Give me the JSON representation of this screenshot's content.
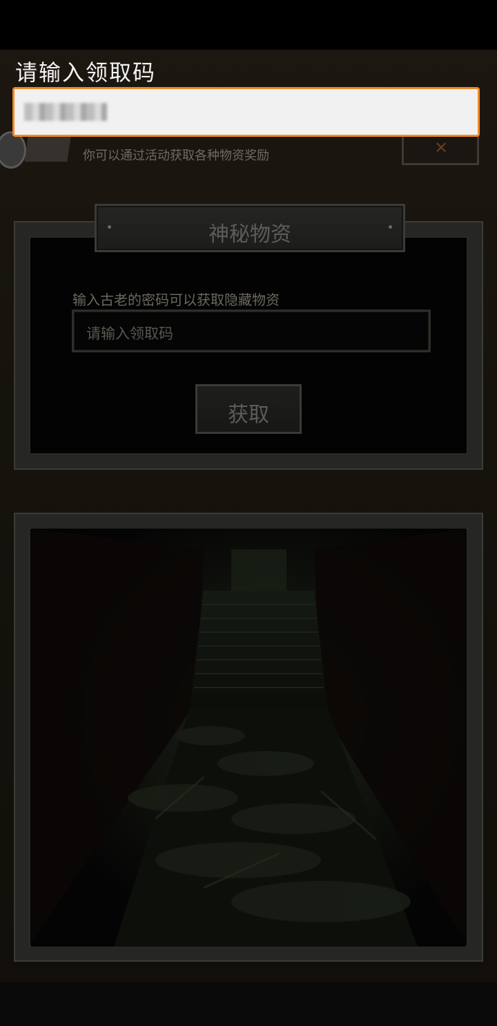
{
  "ime": {
    "prompt": "请输入领取码"
  },
  "header": {
    "subtitle": "你可以通过活动获取各种物资奖励"
  },
  "redeem_panel": {
    "title": "神秘物资",
    "description": "输入古老的密码可以获取隐藏物资",
    "code_placeholder": "请输入领取码",
    "get_button_label": "获取"
  },
  "colors": {
    "ime_border": "#f08a24",
    "ime_background": "#f1f1f1",
    "panel_frame": "#2a2a28",
    "text_muted": "#6c6860"
  },
  "icons": {
    "close": "close-x-icon",
    "header": "activity-icon"
  }
}
